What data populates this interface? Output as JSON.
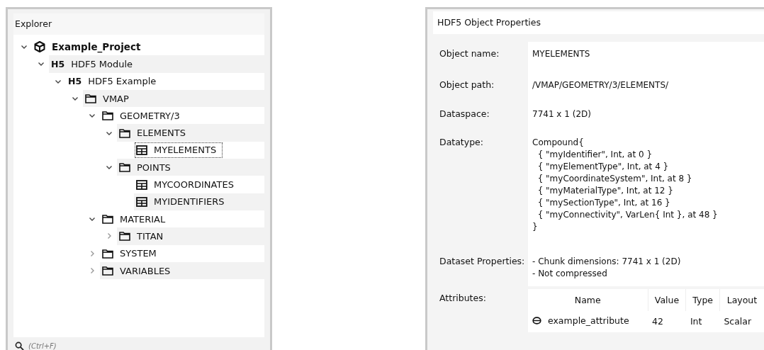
{
  "explorer": {
    "title": "Explorer",
    "tree": [
      {
        "label": "Example_Project",
        "kind": "project",
        "expanded": true,
        "selected": false,
        "children": [
          {
            "label": "HDF5 Module",
            "kind": "h5",
            "icon_text": "H5",
            "expanded": true,
            "selected": false,
            "children": [
              {
                "label": "HDF5 Example",
                "kind": "h5",
                "icon_text": "H5",
                "expanded": true,
                "selected": false,
                "children": [
                  {
                    "label": "VMAP",
                    "kind": "folder",
                    "expanded": true,
                    "selected": false,
                    "children": [
                      {
                        "label": "GEOMETRY/3",
                        "kind": "folder",
                        "expanded": true,
                        "selected": false,
                        "children": [
                          {
                            "label": "ELEMENTS",
                            "kind": "folder",
                            "expanded": true,
                            "selected": false,
                            "children": [
                              {
                                "label": "MYELEMENTS",
                                "kind": "dataset",
                                "selected": true
                              }
                            ]
                          },
                          {
                            "label": "POINTS",
                            "kind": "folder",
                            "expanded": true,
                            "selected": false,
                            "children": [
                              {
                                "label": "MYCOORDINATES",
                                "kind": "dataset",
                                "selected": false
                              },
                              {
                                "label": "MYIDENTIFIERS",
                                "kind": "dataset",
                                "selected": false
                              }
                            ]
                          }
                        ]
                      },
                      {
                        "label": "MATERIAL",
                        "kind": "folder",
                        "expanded": true,
                        "selected": false,
                        "children": [
                          {
                            "label": "TITAN",
                            "kind": "folder",
                            "expanded": false,
                            "selected": false
                          }
                        ]
                      },
                      {
                        "label": "SYSTEM",
                        "kind": "folder",
                        "expanded": false,
                        "selected": false
                      },
                      {
                        "label": "VARIABLES",
                        "kind": "folder",
                        "expanded": false,
                        "selected": false
                      }
                    ]
                  }
                ]
              }
            ]
          }
        ]
      }
    ],
    "search": {
      "placeholder": "(Ctrl+F)"
    }
  },
  "properties": {
    "title": "HDF5 Object Properties",
    "fields": [
      {
        "label": "Object name:",
        "value": "MYELEMENTS"
      },
      {
        "label": "Object path:",
        "value": "/VMAP/GEOMETRY/3/ELEMENTS/"
      },
      {
        "label": "Dataspace:",
        "value": "7741 x 1 (2D)"
      },
      {
        "label": "Datatype:",
        "value": "Compound{\n  { \"myIdentifier\", Int, at 0 }\n  { \"myElementType\", Int, at 4 }\n  { \"myCoordinateSystem\", Int, at 8 }\n  { \"myMaterialType\", Int, at 12 }\n  { \"mySectionType\", Int, at 16 }\n  { \"myConnectivity\", VarLen{ Int }, at 48 }\n}"
      },
      {
        "label": "Dataset Properties:",
        "value": "- Chunk dimensions: 7741 x 1 (2D)\n- Not compressed"
      }
    ],
    "attributes": {
      "label": "Attributes:",
      "columns": [
        "Name",
        "Value",
        "Type",
        "Layout"
      ],
      "rows": [
        [
          "example_attribute",
          "42",
          "Int",
          "Scalar"
        ]
      ]
    }
  }
}
